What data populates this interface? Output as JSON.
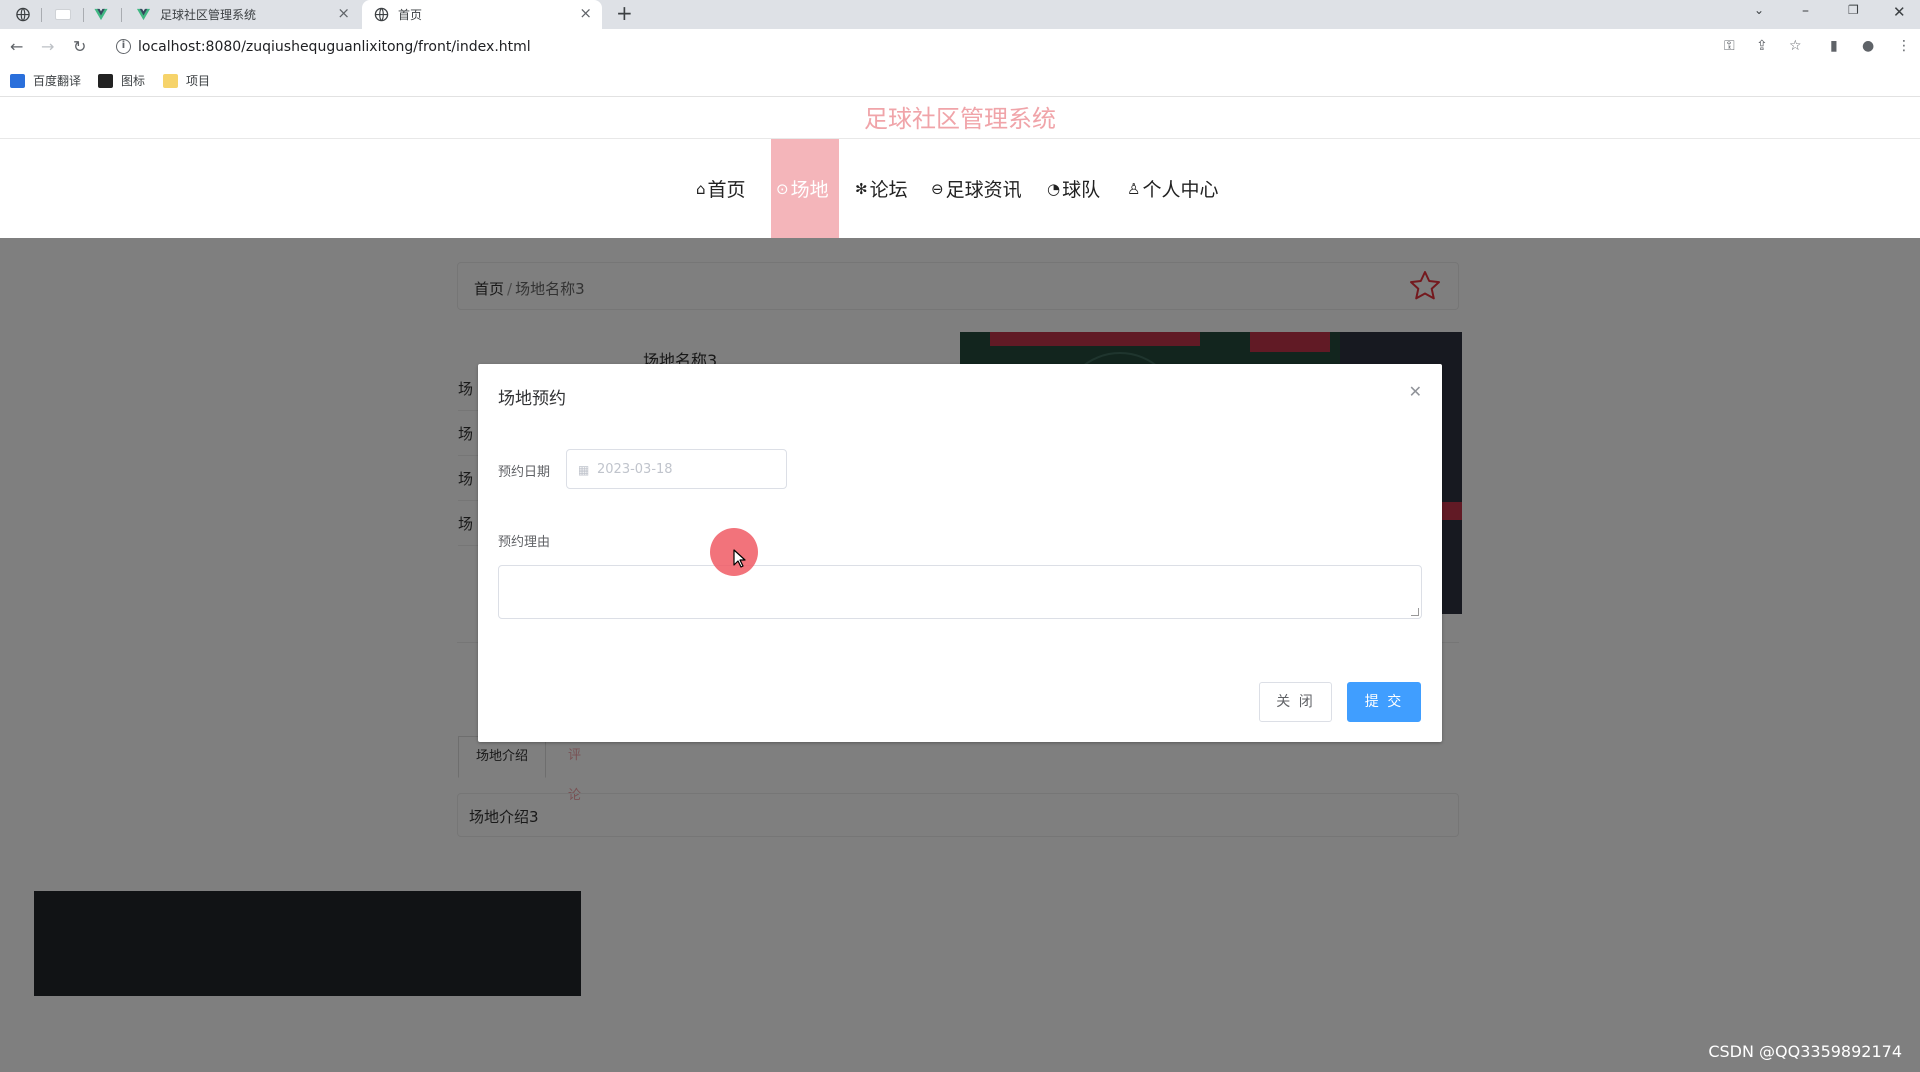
{
  "browser": {
    "tabs": [
      {
        "title": "足球社区管理系统",
        "icon": "vue-logo-icon"
      },
      {
        "title": "首页",
        "icon": "globe-icon"
      }
    ],
    "new_tab": "+",
    "url": "localhost:8080/zuqiushequguanlixitong/front/index.html",
    "bookmarks": [
      {
        "label": "百度翻译",
        "icon": "baidu-translate-icon"
      },
      {
        "label": "图标",
        "icon": "image-icon"
      },
      {
        "label": "项目",
        "icon": "folder-icon"
      }
    ]
  },
  "site": {
    "title": "足球社区管理系统",
    "nav": [
      {
        "icon": "⌂",
        "label": "首页"
      },
      {
        "icon": "⊙",
        "label": "场地",
        "active": true
      },
      {
        "icon": "✻",
        "label": "论坛"
      },
      {
        "icon": "⊖",
        "label": "足球资讯"
      },
      {
        "icon": "◔",
        "label": "球队"
      },
      {
        "icon": "♙",
        "label": "个人中心"
      }
    ]
  },
  "breadcrumb": {
    "home": "首页",
    "separator": "/",
    "current": "场地名称3"
  },
  "venue": {
    "name": "场地名称3",
    "row_prefix": "场"
  },
  "tabs": {
    "intro": "场地介绍",
    "comment": "评论"
  },
  "intro_text": "场地介绍3",
  "dialog": {
    "title": "场地预约",
    "date_label": "预约日期",
    "date_value": "2023-03-18",
    "reason_label": "预约理由",
    "reason_value": "",
    "close_button": "关 闭",
    "submit_button": "提 交"
  },
  "watermark": "CSDN @QQ3359892174",
  "colors": {
    "brand_pink": "#f0a4a9",
    "primary_blue": "#409eff"
  }
}
